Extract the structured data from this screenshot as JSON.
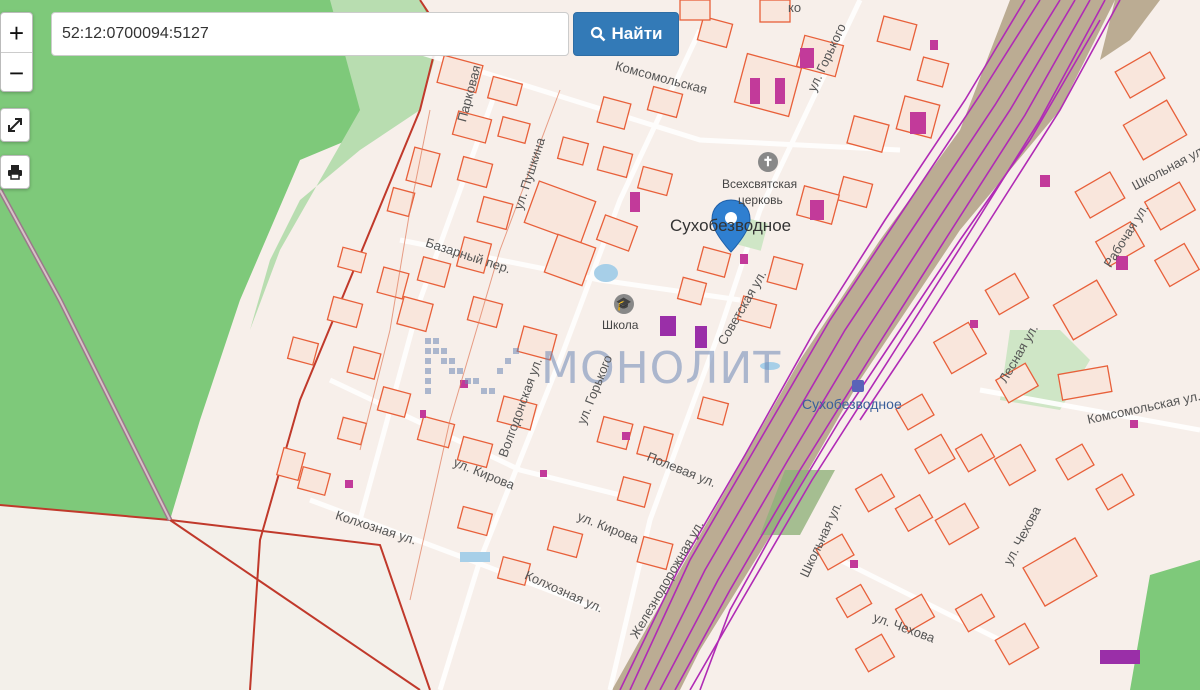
{
  "search": {
    "value": "52:12:0700094:5127",
    "button_label": "Найти"
  },
  "controls": {
    "zoom_in": "+",
    "zoom_out": "−",
    "fullscreen": "⤢",
    "print": "🖶"
  },
  "map_labels": {
    "settlement": "Сухобезводное",
    "settlement_small": "Сухобезводное",
    "church": "Всехсвятская церковь",
    "church_line1": "Всехсвятская",
    "church_line2": "церковь",
    "school": "Школа",
    "watermark": "МОНОЛИТ",
    "streets": {
      "parkovaya": "Парковая",
      "pushkina": "ул. Пушкина",
      "gorkogo_top": "ул. Горького",
      "gorkogo_mid": "ул. Горького",
      "komsomolskaya_top": "Комсомольская",
      "bazarny": "Базарный пер.",
      "volgodonskaya": "Волгодонская ул.",
      "sovetskaya": "Советская ул.",
      "kirova_left": "ул. Кирова",
      "kirova_mid": "ул. Кирова",
      "polevaya": "Полевая ул.",
      "kolkhoznaya_left": "Колхозная ул.",
      "kolkhoznaya_mid": "Колхозная ул.",
      "zheleznodorozhnaya": "Железнодорожная ул.",
      "shkolnaya_left": "Школьная ул.",
      "shkolnaya_right": "Школьная ул.",
      "chekhova_mid": "ул. Чехова",
      "chekhova_right": "ул. Чехова",
      "lesnaya": "Лесная ул.",
      "komsomolskaya_right": "Комсомольская ул.",
      "rabochaya": "Рабочая ул.",
      "ko": "ко"
    }
  },
  "colors": {
    "forest": "#7ec97a",
    "meadow": "#b8ddb0",
    "railway_zone": "#b0a084",
    "parcel_stroke": "#e8603a",
    "rail_lines": "#b02bb5",
    "pin": "#2f7fd0"
  }
}
